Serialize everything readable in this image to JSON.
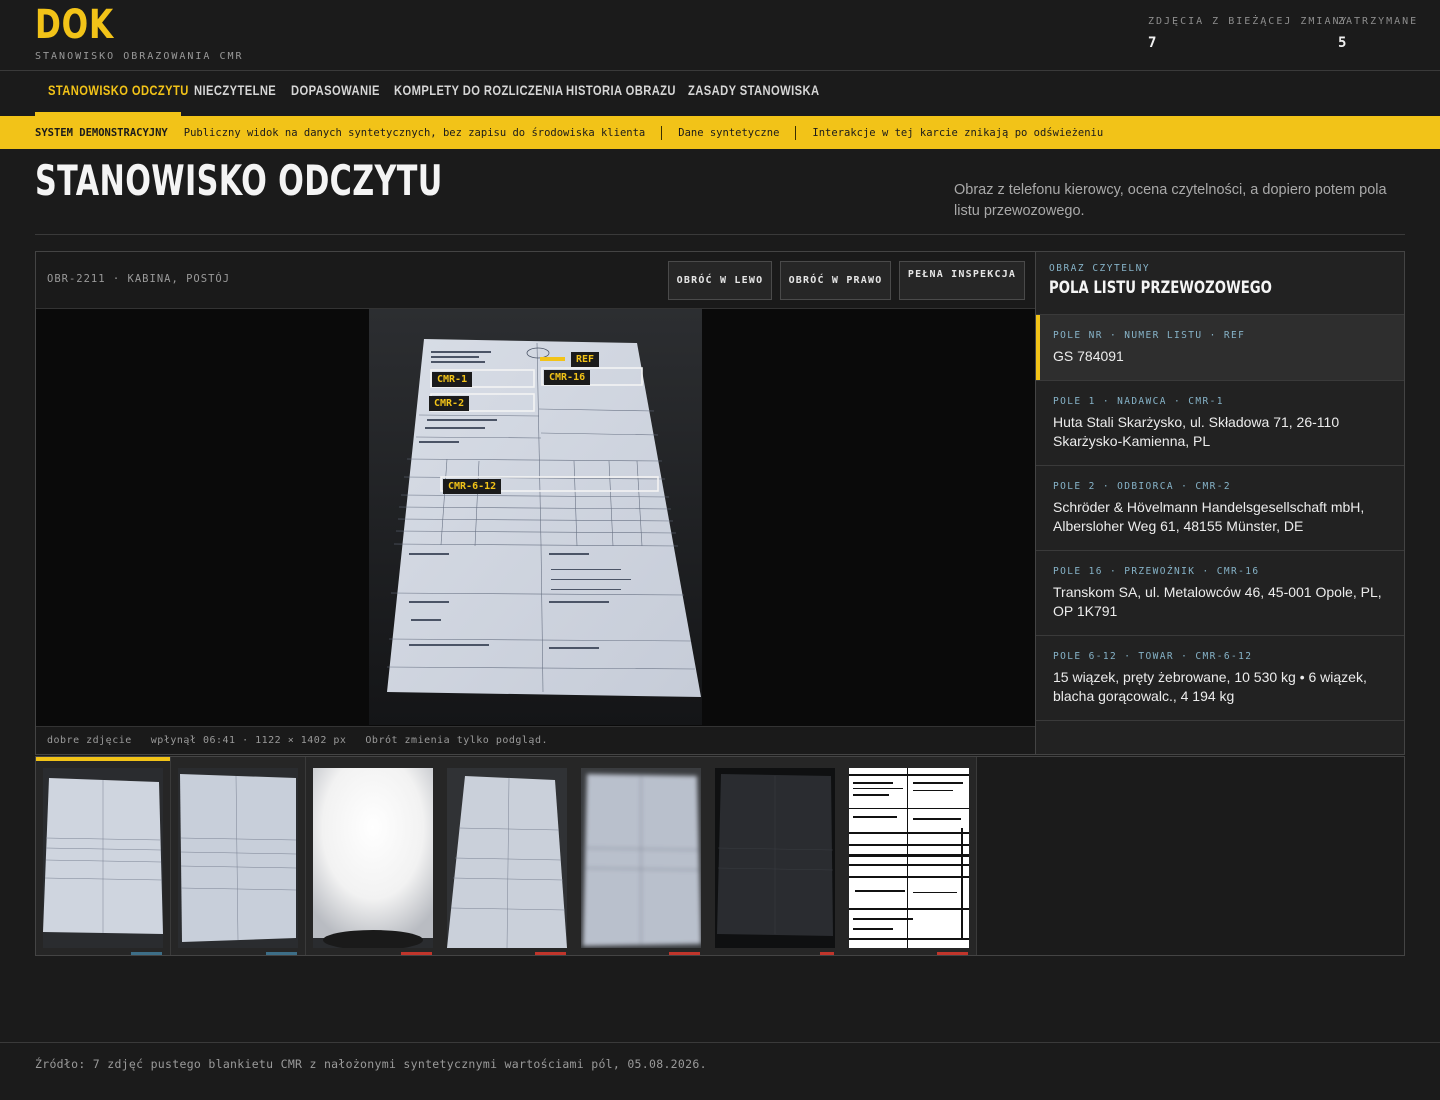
{
  "app": {
    "logo": "DOK",
    "subtitle": "STANOWISKO OBRAZOWANIA CMR"
  },
  "stats": [
    {
      "label": "ZDJĘCIA Z BIEŻĄCEJ ZMIANY",
      "value": "7"
    },
    {
      "label": "ZATRZYMANE",
      "value": "5"
    }
  ],
  "nav": {
    "items": [
      {
        "label": "STANOWISKO ODCZYTU",
        "active": true
      },
      {
        "label": "NIECZYTELNE"
      },
      {
        "label": "DOPASOWANIE"
      },
      {
        "label": "KOMPLETY DO ROZLICZENIA"
      },
      {
        "label": "HISTORIA OBRAZU"
      },
      {
        "label": "ZASADY STANOWISKA"
      }
    ]
  },
  "banner": {
    "title": "SYSTEM DEMONSTRACYJNY",
    "items": [
      "Publiczny widok na danych syntetycznych, bez zapisu do środowiska klienta",
      "Dane syntetyczne",
      "Interakcje w tej karcie znikają po odświeżeniu"
    ]
  },
  "page": {
    "title": "STANOWISKO ODCZYTU",
    "description": "Obraz z telefonu kierowcy, ocena czytelności, a dopiero potem pola listu przewozowego."
  },
  "viewer": {
    "image_id": "OBR-2211 · KABINA, POSTÓJ",
    "buttons": {
      "rotate_left": "OBRÓĆ W LEWO",
      "rotate_right": "OBRÓĆ W PRAWO",
      "inspect": "PEŁNA INSPEKCJA"
    },
    "overlay_tags": [
      "REF",
      "CMR-1",
      "CMR-16",
      "CMR-2",
      "CMR-6-12"
    ],
    "footer": {
      "quality": "dobre zdjęcie",
      "meta": "wpłynął 06:41 · 1122 × 1402 px",
      "note": "Obrót zmienia tylko podgląd."
    }
  },
  "fields_panel": {
    "subtitle": "OBRAZ CZYTELNY",
    "title": "POLA LISTU PRZEWOZOWEGO",
    "fields": [
      {
        "label": "POLE NR · NUMER LISTU · REF",
        "value": "GS 784091",
        "active": true
      },
      {
        "label": "POLE 1 · NADAWCA · CMR-1",
        "value": "Huta Stali Skarżysko, ul. Składowa 71, 26-110 Skarżysko-Kamienna, PL"
      },
      {
        "label": "POLE 2 · ODBIORCA · CMR-2",
        "value": "Schröder & Hövelmann Handelsgesellschaft mbH, Albersloher Weg 61, 48155 Münster, DE"
      },
      {
        "label": "POLE 16 · PRZEWOŹNIK · CMR-16",
        "value": "Transkom SA, ul. Metalowców 46, 45-001 Opole, PL, OP 1K791"
      },
      {
        "label": "POLE 6-12 · TOWAR · CMR-6-12",
        "value": "15 wiązek, pręty żebrowane, 10 530 kg • 6 wiązek, blacha gorącowalc., 4 194 kg"
      }
    ]
  },
  "thumbnails": [
    {
      "kind": "normal",
      "status_color": "#3d6e87",
      "active": true
    },
    {
      "kind": "normal",
      "status_color": "#3d6e87"
    },
    {
      "kind": "glare",
      "status_color": "#c0352b"
    },
    {
      "kind": "angle",
      "status_color": "#c0352b"
    },
    {
      "kind": "blur",
      "status_color": "#c0352b"
    },
    {
      "kind": "dark",
      "status_color": "#c0352b"
    },
    {
      "kind": "scan",
      "status_color": "#c0352b"
    }
  ],
  "footer": {
    "source": "Źródło: 7 zdjęć pustego blankietu CMR z nałożonymi syntetycznymi wartościami pól, 05.08.2026."
  },
  "colors": {
    "accent": "#f2c318",
    "label_blue": "#86b3c8",
    "ok": "#3d6e87",
    "bad": "#c0352b"
  }
}
